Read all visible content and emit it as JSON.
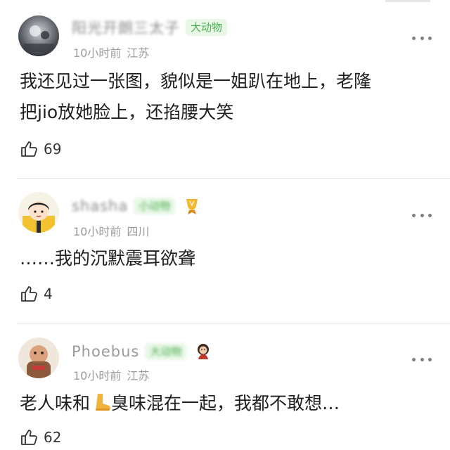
{
  "comments": [
    {
      "username": "阳光开朗三太子",
      "badge": "大动物",
      "time": "10小时前",
      "location": "江苏",
      "text_line1": "我还见过一张图，貌似是一姐趴在地上，老隆",
      "text_line2": "把jio放她脸上，还掐腰大笑",
      "likes": "69"
    },
    {
      "username": "shasha",
      "badge": "小动物",
      "time": "10小时前",
      "location": "四川",
      "text": "……我的沉默震耳欲聋",
      "likes": "4"
    },
    {
      "username": "Phoebus",
      "badge": "大动物",
      "time": "10小时前",
      "location": "江苏",
      "text_before": "老人味和",
      "emoji": "foot-emoji",
      "text_after": "臭味混在一起，我都不敢想…",
      "likes": "62"
    }
  ],
  "icons": {
    "like": "thumbs-up-icon",
    "more": "more-dots-icon"
  },
  "colors": {
    "badge_bg": "#e8f7e6",
    "badge_text": "#4caf50",
    "meta_text": "#9b9b9b",
    "divider": "#e5e5e5"
  }
}
